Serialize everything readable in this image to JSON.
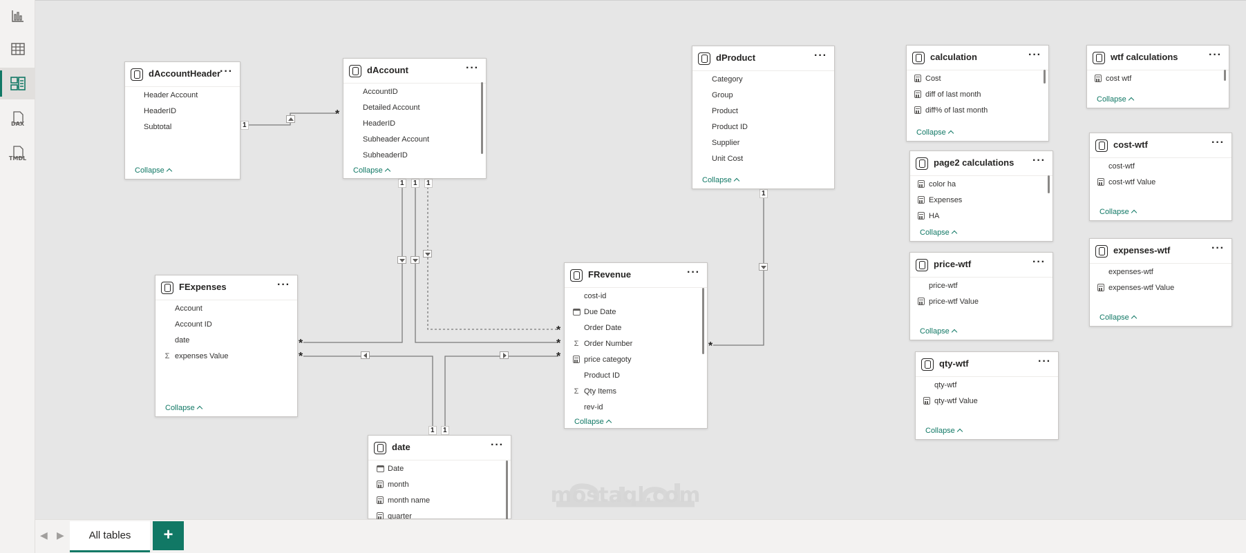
{
  "rail": {
    "items": [
      {
        "name": "report-view-icon"
      },
      {
        "name": "table-view-icon"
      },
      {
        "name": "model-view-icon",
        "active": true
      },
      {
        "name": "dax-query-view-icon",
        "label": "DAX"
      },
      {
        "name": "tmdl-view-icon",
        "label": "TMDL"
      }
    ]
  },
  "cards": {
    "dAccountHeader": {
      "title": "dAccountHeader",
      "fields": [
        "Header Account",
        "HeaderID",
        "Subtotal"
      ],
      "collapse": "Collapse"
    },
    "dAccount": {
      "title": "dAccount",
      "fields": [
        "AccountID",
        "Detailed Account",
        "HeaderID",
        "Subheader Account",
        "SubheaderID"
      ],
      "collapse": "Collapse"
    },
    "dProduct": {
      "title": "dProduct",
      "fields": [
        "Category",
        "Group",
        "Product",
        "Product ID",
        "Supplier",
        "Unit Cost"
      ],
      "collapse": "Collapse"
    },
    "FExpenses": {
      "title": "FExpenses",
      "fields": [
        "Account",
        "Account ID",
        "date",
        "expenses Value"
      ],
      "collapse": "Collapse"
    },
    "FRevenue": {
      "title": "FRevenue",
      "fields": [
        "cost-id",
        "Due Date",
        "Order Date",
        "Order Number",
        "price categoty",
        "Product ID",
        "Qty Items",
        "rev-id"
      ],
      "collapse": "Collapse"
    },
    "date": {
      "title": "date",
      "fields": [
        "Date",
        "month",
        "month name",
        "quarter"
      ]
    },
    "calculation": {
      "title": "calculation",
      "fields": [
        "Cost",
        "diff of last month",
        "diff% of last month"
      ],
      "collapse": "Collapse"
    },
    "page2": {
      "title": "page2 calculations",
      "fields": [
        "color ha",
        "Expenses",
        "HA"
      ],
      "collapse": "Collapse"
    },
    "priceWtf": {
      "title": "price-wtf",
      "fields": [
        "price-wtf",
        "price-wtf Value"
      ],
      "collapse": "Collapse"
    },
    "qtyWtf": {
      "title": "qty-wtf",
      "fields": [
        "qty-wtf",
        "qty-wtf Value"
      ],
      "collapse": "Collapse"
    },
    "wtfCalc": {
      "title": "wtf calculations",
      "fields": [
        "cost wtf"
      ],
      "collapse": "Collapse"
    },
    "costWtf": {
      "title": "cost-wtf",
      "fields": [
        "cost-wtf",
        "cost-wtf Value"
      ],
      "collapse": "Collapse"
    },
    "expensesWtf": {
      "title": "expenses-wtf",
      "fields": [
        "expenses-wtf",
        "expenses-wtf Value"
      ],
      "collapse": "Collapse"
    }
  },
  "more_label": "···",
  "cardinality": {
    "one": "1",
    "many": "*"
  },
  "watermark": "mostaql.com",
  "tabs": {
    "all_tables": "All tables",
    "add_label": "+"
  },
  "colors": {
    "accent": "#117865",
    "canvas": "#e6e6e6"
  }
}
